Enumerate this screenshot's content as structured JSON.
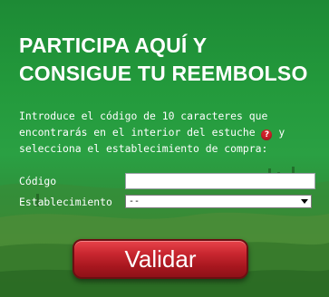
{
  "title": "PARTICIPA AQUÍ Y CONSIGUE TU REEMBOLSO",
  "intro": {
    "before_icon": "Introduce el código de 10 caracteres que encontrarás en el interior del estuche",
    "icon_glyph": "?",
    "after_icon": " y selecciona el establecimiento de compra:"
  },
  "form": {
    "code_label": "Código",
    "code_value": "",
    "store_label": "Establecimiento",
    "store_selected": "--"
  },
  "submit_label": "Validar",
  "colors": {
    "background_green": "#239a3c",
    "button_red": "#c92730",
    "text": "#ffffff"
  },
  "icons": {
    "help": "question-icon",
    "select_arrow": "chevron-down-icon"
  }
}
